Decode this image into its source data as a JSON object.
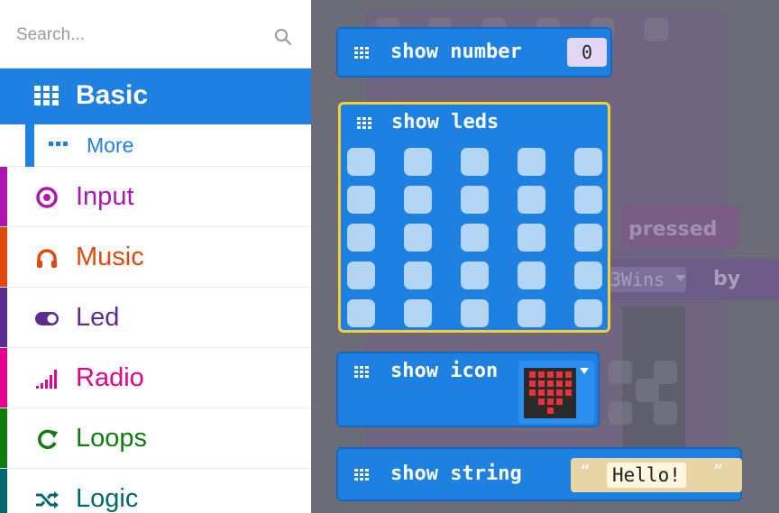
{
  "search": {
    "placeholder": "Search..."
  },
  "sidebar": {
    "basic": {
      "label": "Basic",
      "color": "#1e80e1"
    },
    "more": {
      "label": "More"
    },
    "categories": [
      {
        "label": "Input",
        "color": "#b015b0",
        "icon": "target-icon"
      },
      {
        "label": "Music",
        "color": "#e0490d",
        "icon": "headphones-icon"
      },
      {
        "label": "Led",
        "color": "#5c2d91",
        "icon": "toggle-icon"
      },
      {
        "label": "Radio",
        "color": "#e2008c",
        "icon": "signal-bars-icon"
      },
      {
        "label": "Loops",
        "color": "#107c10",
        "icon": "loop-icon"
      },
      {
        "label": "Logic",
        "color": "#006970",
        "icon": "shuffle-icon"
      }
    ]
  },
  "workspace": {
    "bg_labels": {
      "pressed": "pressed",
      "wins": "3Wins",
      "by": "by"
    },
    "blocks": {
      "show_number": {
        "label": "show number",
        "value": "0"
      },
      "show_leds": {
        "label": "show leds"
      },
      "show_icon": {
        "label": "show icon"
      },
      "show_string": {
        "label": "show string",
        "open_quote": "“",
        "value": "Hello!",
        "close_quote": "”"
      }
    }
  }
}
